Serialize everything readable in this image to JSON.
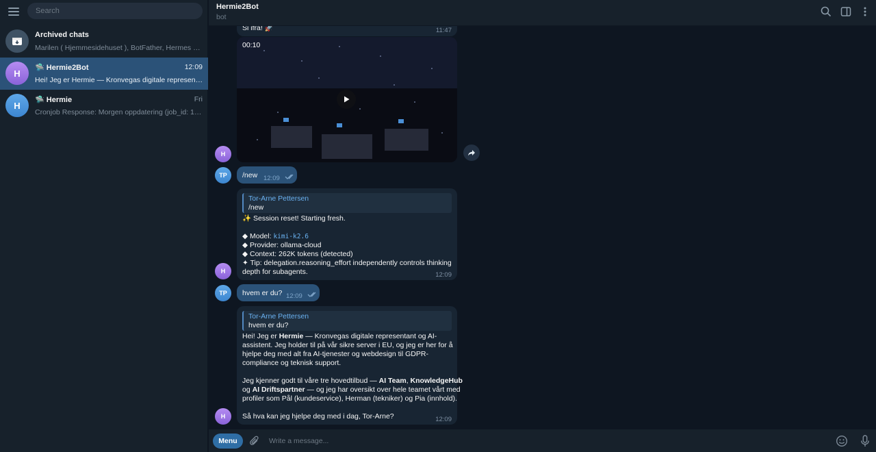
{
  "sidebar": {
    "search_placeholder": "Search",
    "chats": [
      {
        "title": "Archived chats",
        "subtitle": "Marilen ( Hjemmesidehuset ), BotFather, Hermes Ho...",
        "time": "",
        "avatar": "archive-icon"
      },
      {
        "title": "Hermie2Bot",
        "subtitle": "Hei! Jeg er Hermie — Kronvegas digitale representan...",
        "time": "12:09",
        "avatar_letter": "H",
        "bot_icon": "🛸"
      },
      {
        "title": "Hermie",
        "subtitle": "Cronjob Response: Morgen oppdatering (job_id: 1ba...",
        "time": "Fri",
        "avatar_letter": "H",
        "bot_icon": "🛸"
      }
    ]
  },
  "header": {
    "title": "Hermie2Bot",
    "subtitle": "bot"
  },
  "messages": {
    "m1": {
      "text": "Si ifra! 🚀",
      "time": "11:47"
    },
    "video": {
      "duration": "00:10"
    },
    "m2": {
      "text": "/new",
      "time": "12:09",
      "sender_initials": "TP"
    },
    "m3": {
      "quote_name": "Tor-Arne Pettersen",
      "quote_text": "/new",
      "l1": "✨ Session reset! Starting fresh.",
      "l2_prefix": "◆ Model: ",
      "l2_code": "kimi-k2.6",
      "l3": "◆ Provider: ollama-cloud",
      "l4": "◆ Context: 262K tokens (detected)",
      "l5": "✦ Tip: delegation.reasoning_effort independently controls thinking",
      "l6": "depth for subagents.",
      "time": "12:09",
      "sender_initials": "H"
    },
    "m4": {
      "text": "hvem er du?",
      "time": "12:09",
      "sender_initials": "TP"
    },
    "m5": {
      "quote_name": "Tor-Arne Pettersen",
      "quote_text": "hvem er du?",
      "p1a": "Hei! Jeg er ",
      "p1b": "Hermie",
      "p1c": " — Kronvegas digitale representant og AI-",
      "p1l2": "assistent. Jeg holder til på vår sikre server i EU, og jeg er her for å",
      "p1l3": "hjelpe deg med alt fra AI-tjenester og webdesign til GDPR-",
      "p1l4": "compliance og teknisk support.",
      "p2a": "Jeg kjenner godt til våre tre hovedtilbud — ",
      "p2b": "AI Team",
      "p2c": ", ",
      "p2d": "KnowledgeHub",
      "p2l2a": "og ",
      "p2l2b": "AI Driftspartner",
      "p2l2c": " — og jeg har oversikt over hele teamet vårt med",
      "p2l3": "profiler som Pål (kundeservice), Herman (tekniker) og Pia (innhold).",
      "p3": "Så hva kan jeg hjelpe deg med i dag, Tor-Arne?",
      "time": "12:09",
      "sender_initials": "H"
    }
  },
  "composer": {
    "menu_label": "Menu",
    "placeholder": "Write a message..."
  },
  "colors": {
    "accent": "#2b5278",
    "link": "#6ab2f2",
    "background": "#0e1621",
    "panel": "#17212b"
  }
}
